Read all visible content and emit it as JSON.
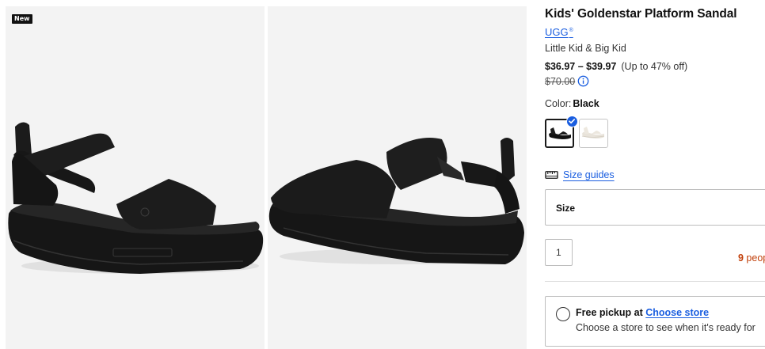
{
  "gallery": {
    "badge": "New"
  },
  "product": {
    "title": "Kids' Goldenstar Platform Sandal",
    "brand": "UGG",
    "brand_mark": "®",
    "age_range": "Little Kid & Big Kid",
    "price_range": "$36.97 – $39.97",
    "discount": "(Up to 47% off)",
    "original_price": "$70.00",
    "color_label": "Color:",
    "color_value": "Black",
    "swatches": [
      {
        "name": "Black",
        "color": "#111111",
        "selected": true
      },
      {
        "name": "White",
        "color": "#f1ede6",
        "selected": false
      }
    ]
  },
  "size": {
    "guide_link": "Size guides",
    "select_label": "Size"
  },
  "quantity": {
    "value": "1"
  },
  "social_proof": {
    "count": "9",
    "text": " peop"
  },
  "pickup": {
    "title_prefix": "Free pickup at ",
    "choose_store": "Choose store",
    "subtitle": "Choose a store to see when it's ready for"
  },
  "colors": {
    "accent_blue": "#1a5ee0",
    "social_proof_orange": "#c2410c",
    "photo_bg": "#f3f3f3"
  }
}
